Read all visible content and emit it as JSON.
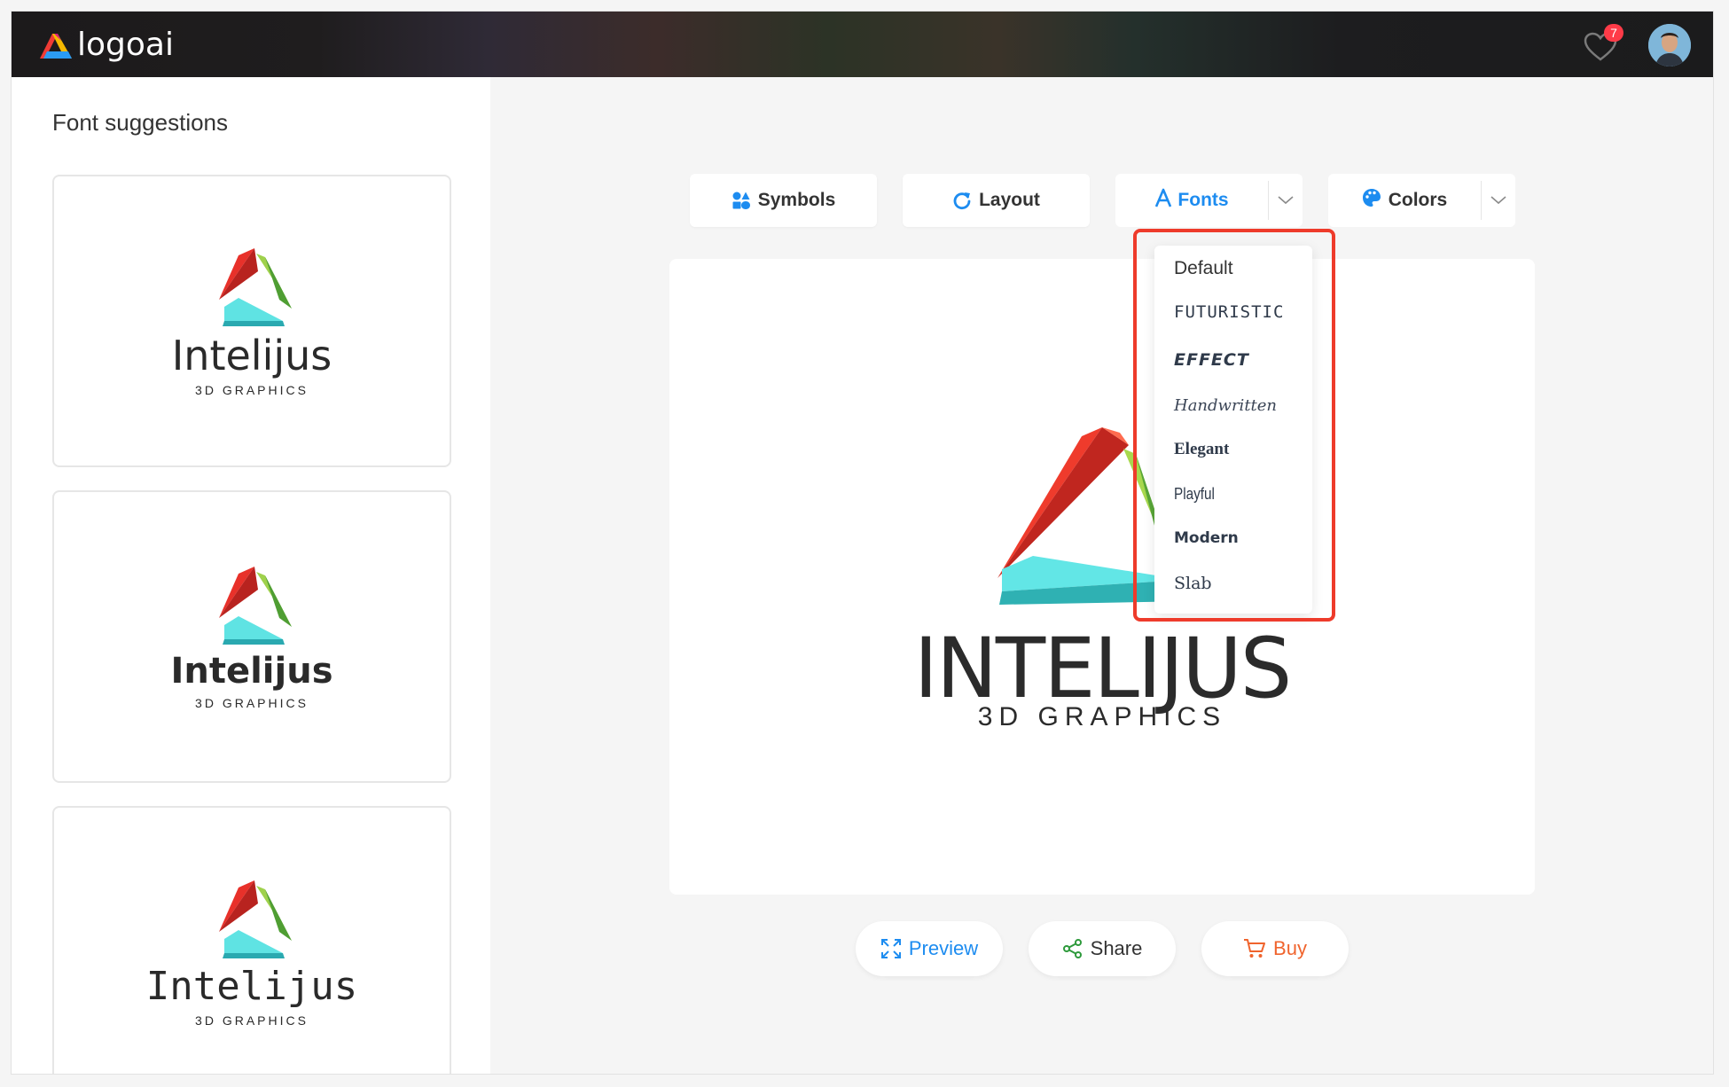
{
  "app": {
    "name": "logoai"
  },
  "header": {
    "favorites_count": "7",
    "brand_colors": {
      "red": "#ef3b35",
      "yellow": "#f5b800",
      "blue": "#2b9bf4"
    }
  },
  "sidebar": {
    "title": "Font suggestions",
    "suggestions": [
      {
        "name": "Intelijus",
        "tagline": "3D GRAPHICS"
      },
      {
        "name": "Intelijus",
        "tagline": "3D GRAPHICS"
      },
      {
        "name": "Intelijus",
        "tagline": "3D GRAPHICS"
      }
    ]
  },
  "toolbar": {
    "symbols": "Symbols",
    "layout": "Layout",
    "fonts": "Fonts",
    "colors": "Colors",
    "accent": "#1d8cf0"
  },
  "fonts_menu": {
    "items": [
      "Default",
      "FUTURISTIC",
      "EFFECT",
      "Handwritten",
      "Elegant",
      "Playful",
      "Modern",
      "Slab"
    ]
  },
  "canvas": {
    "name": "INTELIJUS",
    "tagline": "3D GRAPHICS"
  },
  "actions": {
    "preview": "Preview",
    "share": "Share",
    "buy": "Buy",
    "preview_color": "#1d8cf0",
    "share_color": "#2e9a3c",
    "buy_color": "#f0642d"
  }
}
